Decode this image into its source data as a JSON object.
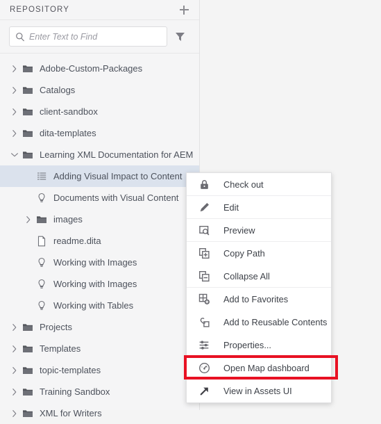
{
  "panel": {
    "title": "REPOSITORY",
    "add_icon": "plus-icon",
    "search": {
      "placeholder": "Enter Text to Find",
      "value": "",
      "search_icon": "search-icon",
      "filter_icon": "filter-icon"
    }
  },
  "tree": {
    "items": [
      {
        "label": "Adobe-Custom-Packages",
        "icon": "folder-icon",
        "twisty": "chevron-right-icon",
        "indent": 0,
        "selected": false
      },
      {
        "label": "Catalogs",
        "icon": "folder-icon",
        "twisty": "chevron-right-icon",
        "indent": 0,
        "selected": false
      },
      {
        "label": "client-sandbox",
        "icon": "folder-icon",
        "twisty": "chevron-right-icon",
        "indent": 0,
        "selected": false
      },
      {
        "label": "dita-templates",
        "icon": "folder-icon",
        "twisty": "chevron-right-icon",
        "indent": 0,
        "selected": false
      },
      {
        "label": "Learning XML Documentation for AEM",
        "icon": "folder-icon",
        "twisty": "chevron-down-icon",
        "indent": 0,
        "selected": false
      },
      {
        "label": "Adding Visual Impact to Content",
        "icon": "ditamap-icon",
        "twisty": "none",
        "indent": 1,
        "selected": true
      },
      {
        "label": "Documents with Visual Content",
        "icon": "ditatopic-icon",
        "twisty": "none",
        "indent": 1,
        "selected": false
      },
      {
        "label": "images",
        "icon": "folder-icon",
        "twisty": "chevron-right-icon",
        "indent": 1,
        "selected": false
      },
      {
        "label": "readme.dita",
        "icon": "file-icon",
        "twisty": "none",
        "indent": 1,
        "selected": false
      },
      {
        "label": "Working with Images",
        "icon": "ditatopic-icon",
        "twisty": "none",
        "indent": 1,
        "selected": false
      },
      {
        "label": "Working with Images",
        "icon": "ditatopic-icon",
        "twisty": "none",
        "indent": 1,
        "selected": false
      },
      {
        "label": "Working with Tables",
        "icon": "ditatopic-icon",
        "twisty": "none",
        "indent": 1,
        "selected": false
      },
      {
        "label": "Projects",
        "icon": "folder-icon",
        "twisty": "chevron-right-icon",
        "indent": 0,
        "selected": false
      },
      {
        "label": "Templates",
        "icon": "folder-icon",
        "twisty": "chevron-right-icon",
        "indent": 0,
        "selected": false
      },
      {
        "label": "topic-templates",
        "icon": "folder-icon",
        "twisty": "chevron-right-icon",
        "indent": 0,
        "selected": false
      },
      {
        "label": "Training Sandbox",
        "icon": "folder-icon",
        "twisty": "chevron-right-icon",
        "indent": 0,
        "selected": false
      },
      {
        "label": "XML for Writers",
        "icon": "folder-icon",
        "twisty": "chevron-right-icon",
        "indent": 0,
        "selected": false
      }
    ]
  },
  "context_menu": {
    "items": [
      {
        "label": "Check out",
        "icon": "lock-icon",
        "separator": true,
        "highlighted": false
      },
      {
        "label": "Edit",
        "icon": "pencil-icon",
        "separator": true,
        "highlighted": false
      },
      {
        "label": "Preview",
        "icon": "preview-icon",
        "separator": true,
        "highlighted": false
      },
      {
        "label": "Copy Path",
        "icon": "copy-plus-icon",
        "separator": false,
        "highlighted": false
      },
      {
        "label": "Collapse All",
        "icon": "copy-minus-icon",
        "separator": true,
        "highlighted": false
      },
      {
        "label": "Add to Favorites",
        "icon": "grid-plus-icon",
        "separator": false,
        "highlighted": false
      },
      {
        "label": "Add to Reusable Contents",
        "icon": "link-box-icon",
        "separator": false,
        "highlighted": false
      },
      {
        "label": "Properties...",
        "icon": "sliders-icon",
        "separator": false,
        "highlighted": false
      },
      {
        "label": "Open Map dashboard",
        "icon": "gauge-icon",
        "separator": false,
        "highlighted": true
      },
      {
        "label": "View in Assets UI",
        "icon": "external-arrow-icon",
        "separator": false,
        "highlighted": false
      }
    ]
  },
  "colors": {
    "highlight_border": "#e81123",
    "selection_background": "#dbe2ed",
    "panel_background": "#f5f5f6",
    "canvas_background": "#f4f4f4",
    "text": "#4d525c"
  }
}
